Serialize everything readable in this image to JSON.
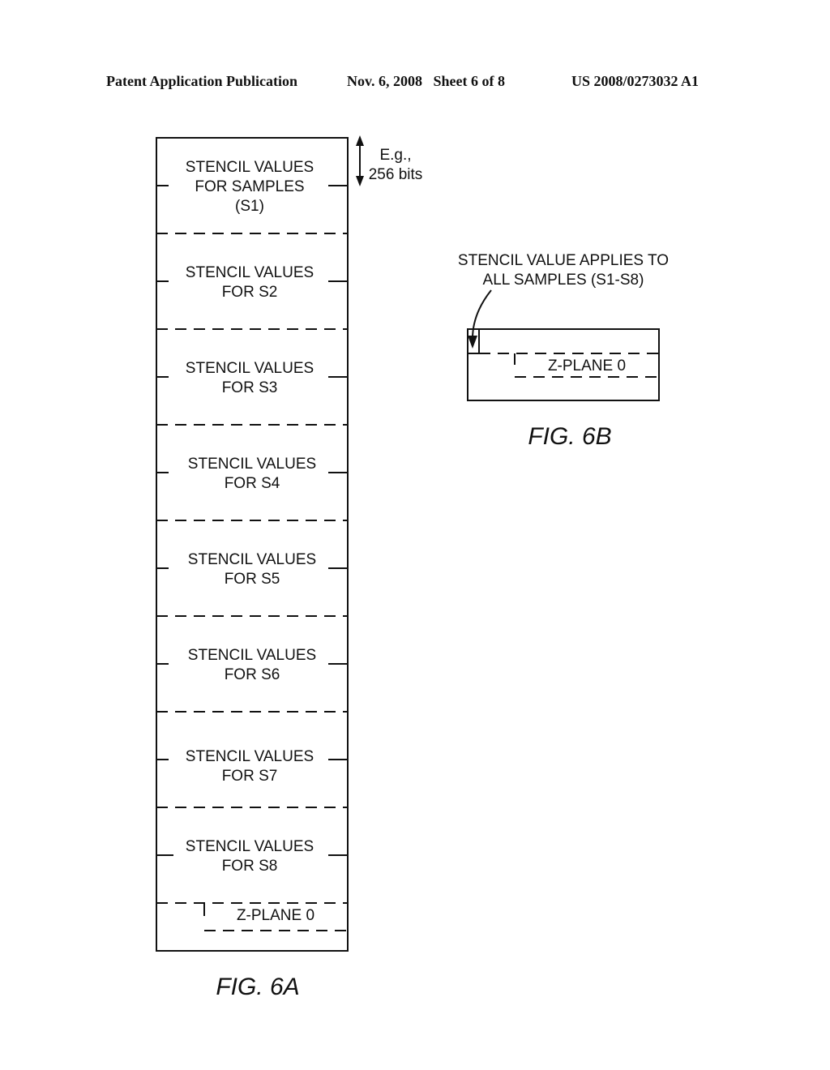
{
  "header": {
    "publication": "Patent Application Publication",
    "date_sheet": "Nov. 6, 2008   Sheet 6 of 8",
    "patent_number": "US 2008/0273032 A1"
  },
  "fig6a": {
    "caption": "FIG. 6A",
    "size_note_line1": "E.g.,",
    "size_note_line2": "256 bits",
    "blocks": [
      {
        "lines": [
          "STENCIL VALUES",
          "FOR SAMPLES",
          "(S1)"
        ]
      },
      {
        "lines": [
          "STENCIL VALUES",
          "FOR S2"
        ]
      },
      {
        "lines": [
          "STENCIL VALUES",
          "FOR S3"
        ]
      },
      {
        "lines": [
          "STENCIL VALUES",
          "FOR S4"
        ]
      },
      {
        "lines": [
          "STENCIL VALUES",
          "FOR S5"
        ]
      },
      {
        "lines": [
          "STENCIL VALUES",
          "FOR S6"
        ]
      },
      {
        "lines": [
          "STENCIL VALUES",
          "FOR S7"
        ]
      },
      {
        "lines": [
          "STENCIL VALUES",
          "FOR S8"
        ]
      }
    ],
    "zplane_label": "Z-PLANE 0"
  },
  "fig6b": {
    "caption": "FIG. 6B",
    "annotation_line1": "STENCIL VALUE APPLIES TO",
    "annotation_line2": "ALL SAMPLES (S1-S8)",
    "zplane_label": "Z-PLANE 0"
  }
}
